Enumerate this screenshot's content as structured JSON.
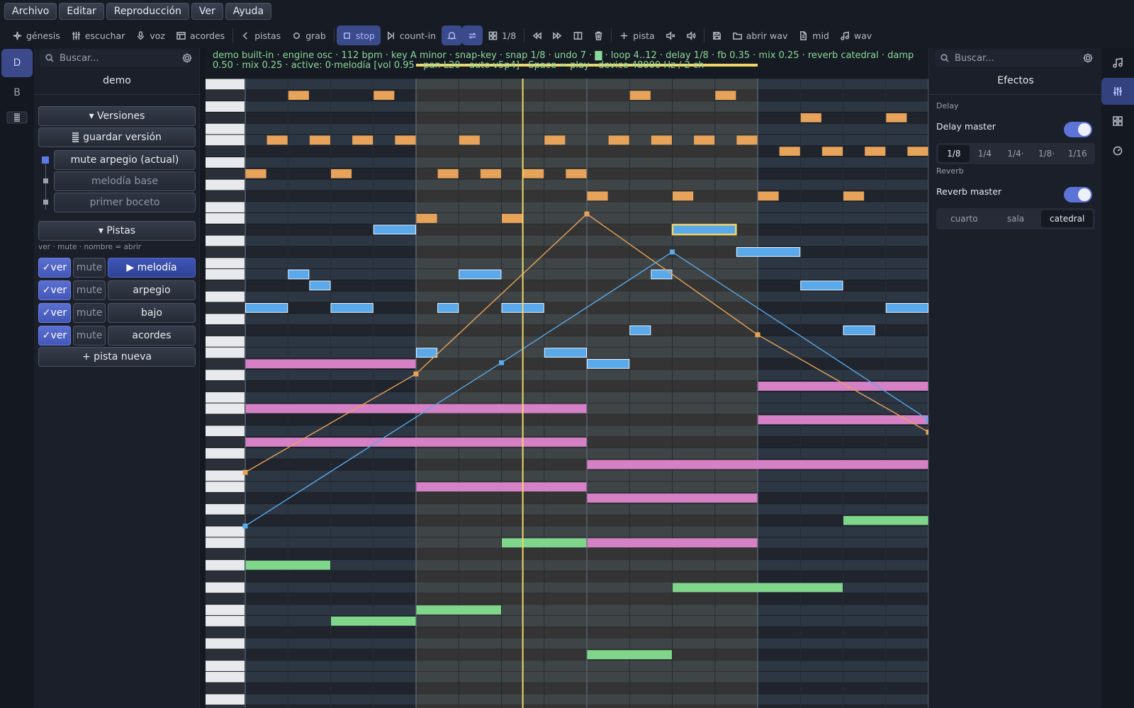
{
  "menu": [
    "Archivo",
    "Editar",
    "Reproducción",
    "Ver",
    "Ayuda"
  ],
  "toolbar": {
    "genesis": "génesis",
    "listen": "escuchar",
    "voice": "voz",
    "chords": "acordes",
    "tracks": "pistas",
    "rec": "grab",
    "stop": "stop",
    "count_in": "count-in",
    "snap": "1/8",
    "add_track": "pista",
    "open_wav": "abrir wav",
    "mid": "mid",
    "wav": "wav"
  },
  "left_rail": {
    "d": "D",
    "b": "B"
  },
  "left_panel": {
    "search_placeholder": "Buscar...",
    "title": "demo",
    "versions_header": "▾ Versiones",
    "save_version": "guardar versión",
    "versions": [
      "mute arpegio  (actual)",
      "melodía base",
      "primer boceto"
    ],
    "tracks_header": "▾ Pistas",
    "tracks_hint": "ver · mute · nombre = abrir",
    "view_label": "✓ver",
    "mute_label": "mute",
    "tracks": [
      "▶ melodía",
      "arpegio",
      "bajo",
      "acordes"
    ],
    "new_track": "+ pista nueva"
  },
  "status_line": "demo built-in  ·  engine osc  ·  112 bpm · key A minor · snap-key · snap 1/8 · undo 7 · ▇ · loop 4..12 · delay 1/8 · fb 0.35 · mix 0.25 · reverb catedral · damp 0.50 · mix 0.25  ·  active: 0·melodía [vol 0.95 · pan L20 · auto v5p4]  ·  Space = play · device 48000 Hz / 2 ch",
  "right_panel": {
    "search_placeholder": "Buscar...",
    "title": "Efectos",
    "delay_section": "Delay",
    "delay_master": "Delay master",
    "delay_on": true,
    "delay_divisions": [
      "1/8",
      "1/4",
      "1/4·",
      "1/8·",
      "1/16"
    ],
    "delay_selected": "1/8",
    "reverb_section": "Reverb",
    "reverb_master": "Reverb master",
    "reverb_on": true,
    "reverb_rooms": [
      "cuarto",
      "sala",
      "catedral"
    ],
    "reverb_selected": "catedral"
  },
  "colors": {
    "accent": "#5c73d8",
    "melody": "#5aa9ea",
    "arpeggio": "#e8a35a",
    "bass": "#7fd68a",
    "chords": "#d680c6",
    "playhead": "#f0d76a",
    "status_text": "#8ad89a"
  },
  "pianoroll": {
    "bars": 16,
    "rows": 56,
    "loop": [
      4,
      12
    ],
    "playhead_bar": 6.5,
    "notes": {
      "arpeggio": [
        [
          1.0,
          1,
          0.5
        ],
        [
          3.0,
          1,
          0.5
        ],
        [
          9.0,
          1,
          0.5
        ],
        [
          11.0,
          1,
          0.5
        ],
        [
          13.0,
          3,
          0.5
        ],
        [
          15.0,
          3,
          0.5
        ],
        [
          0.5,
          5,
          0.5
        ],
        [
          1.5,
          5,
          0.5
        ],
        [
          2.5,
          5,
          0.5
        ],
        [
          3.5,
          5,
          0.5
        ],
        [
          5.0,
          5,
          0.5
        ],
        [
          7.0,
          5,
          0.5
        ],
        [
          8.5,
          5,
          0.5
        ],
        [
          9.5,
          5,
          0.5
        ],
        [
          10.5,
          5,
          0.5
        ],
        [
          11.5,
          5,
          0.5
        ],
        [
          12.5,
          6,
          0.5
        ],
        [
          13.5,
          6,
          0.5
        ],
        [
          14.5,
          6,
          0.5
        ],
        [
          15.5,
          6,
          0.5
        ],
        [
          0.0,
          8,
          0.5
        ],
        [
          2.0,
          8,
          0.5
        ],
        [
          4.5,
          8,
          0.5
        ],
        [
          5.5,
          8,
          0.5
        ],
        [
          6.5,
          8,
          0.5
        ],
        [
          7.5,
          8,
          0.5
        ],
        [
          8.0,
          10,
          0.5
        ],
        [
          10.0,
          10,
          0.5
        ],
        [
          12.0,
          10,
          0.5
        ],
        [
          14.0,
          10,
          0.5
        ],
        [
          4.0,
          12,
          0.5
        ],
        [
          6.0,
          12,
          0.5
        ]
      ],
      "melody": [
        [
          3.0,
          13,
          1.0
        ],
        [
          10.0,
          13,
          1.5
        ],
        [
          11.5,
          15,
          1.5
        ],
        [
          1.0,
          17,
          0.5
        ],
        [
          5.0,
          17,
          1.0
        ],
        [
          9.5,
          17,
          0.5
        ],
        [
          1.5,
          18,
          0.5
        ],
        [
          13.0,
          18,
          1.0
        ],
        [
          0.0,
          20,
          1.0
        ],
        [
          2.0,
          20,
          1.0
        ],
        [
          4.5,
          20,
          0.5
        ],
        [
          6.0,
          20,
          1.0
        ],
        [
          15.0,
          20,
          1.0
        ],
        [
          9.0,
          22,
          0.5
        ],
        [
          14.0,
          22,
          0.75
        ],
        [
          4.0,
          24,
          0.5
        ],
        [
          7.0,
          24,
          1.0
        ],
        [
          8.0,
          25,
          1.0
        ]
      ],
      "chords": [
        [
          0.0,
          25,
          4.0
        ],
        [
          12.0,
          27,
          4.0
        ],
        [
          0.0,
          29,
          8.0
        ],
        [
          12.0,
          30,
          4.0
        ],
        [
          0.0,
          32,
          8.0
        ],
        [
          8.0,
          34,
          8.0
        ],
        [
          4.0,
          36,
          4.0
        ],
        [
          8.0,
          37,
          4.0
        ],
        [
          8.0,
          41,
          4.0
        ]
      ],
      "bass": [
        [
          14.0,
          39,
          2.0
        ],
        [
          6.0,
          41,
          2.0
        ],
        [
          0.0,
          43,
          2.0
        ],
        [
          10.0,
          45,
          4.0
        ],
        [
          4.0,
          47,
          2.0
        ],
        [
          2.0,
          48,
          2.0
        ],
        [
          8.0,
          51,
          2.0
        ]
      ]
    },
    "selected_note": [
      10.0,
      13,
      1.5
    ],
    "automation_orange": [
      [
        0,
        35.2
      ],
      [
        4,
        26.4
      ],
      [
        8,
        12.1
      ],
      [
        12,
        22.9
      ],
      [
        16,
        31.6
      ]
    ],
    "automation_blue": [
      [
        0,
        40.0
      ],
      [
        6,
        25.4
      ],
      [
        10,
        15.5
      ],
      [
        16,
        30.5
      ]
    ]
  }
}
